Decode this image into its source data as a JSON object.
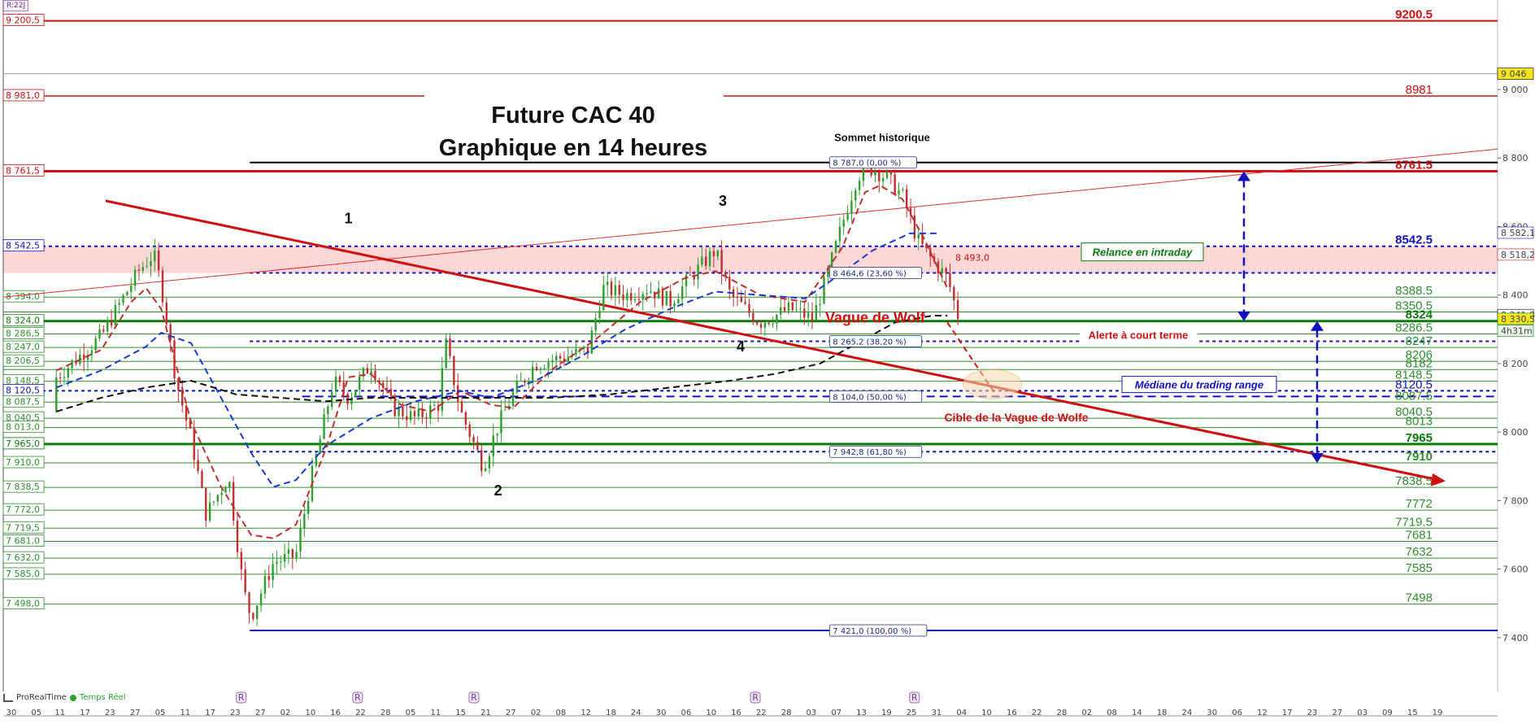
{
  "chart_data": {
    "type": "candlestick",
    "instrument_tag": "R:22J",
    "title_line1": "Future CAC 40",
    "title_line2": "Graphique en 14 heures",
    "footer_brand": "ProRealTime",
    "footer_realtime": "Temps Réel",
    "ylim": [
      7380,
      9240
    ],
    "y_ticks": [
      {
        "value": 9000,
        "label": "9 000"
      },
      {
        "value": 8800,
        "label": "8 800"
      },
      {
        "value": 8600,
        "label": "8 600"
      },
      {
        "value": 8400,
        "label": "8 400"
      },
      {
        "value": 8200,
        "label": "8 200"
      },
      {
        "value": 8000,
        "label": "8 000"
      },
      {
        "value": 7800,
        "label": "7 800"
      },
      {
        "value": 7600,
        "label": "7 600"
      },
      {
        "value": 7400,
        "label": "7 400"
      }
    ],
    "x_ticks": [
      {
        "pos": 0.0,
        "label": "30"
      },
      {
        "pos": 0.017,
        "label": "05"
      },
      {
        "pos": 0.033,
        "label": "11"
      },
      {
        "pos": 0.05,
        "label": "17"
      },
      {
        "pos": 0.067,
        "label": "23"
      },
      {
        "pos": 0.084,
        "label": "27"
      },
      {
        "pos": 0.101,
        "label": "05"
      },
      {
        "pos": 0.118,
        "label": "11"
      },
      {
        "pos": 0.135,
        "label": "17"
      },
      {
        "pos": 0.152,
        "label": "23"
      },
      {
        "pos": 0.169,
        "label": "27"
      },
      {
        "pos": 0.186,
        "label": "02"
      },
      {
        "pos": 0.203,
        "label": "10"
      },
      {
        "pos": 0.22,
        "label": "16"
      },
      {
        "pos": 0.237,
        "label": "22"
      },
      {
        "pos": 0.254,
        "label": "28"
      },
      {
        "pos": 0.271,
        "label": "05"
      },
      {
        "pos": 0.288,
        "label": "11"
      },
      {
        "pos": 0.305,
        "label": "15"
      },
      {
        "pos": 0.322,
        "label": "21"
      },
      {
        "pos": 0.339,
        "label": "27"
      },
      {
        "pos": 0.356,
        "label": "02"
      },
      {
        "pos": 0.373,
        "label": "08"
      },
      {
        "pos": 0.39,
        "label": "12"
      },
      {
        "pos": 0.407,
        "label": "18"
      },
      {
        "pos": 0.424,
        "label": "24"
      },
      {
        "pos": 0.441,
        "label": "30"
      },
      {
        "pos": 0.458,
        "label": "06"
      },
      {
        "pos": 0.475,
        "label": "10"
      },
      {
        "pos": 0.492,
        "label": "16"
      },
      {
        "pos": 0.509,
        "label": "22"
      },
      {
        "pos": 0.526,
        "label": "28"
      },
      {
        "pos": 0.543,
        "label": "03"
      },
      {
        "pos": 0.56,
        "label": "07"
      },
      {
        "pos": 0.577,
        "label": "13"
      },
      {
        "pos": 0.594,
        "label": "19"
      },
      {
        "pos": 0.611,
        "label": "25"
      },
      {
        "pos": 0.628,
        "label": "31"
      },
      {
        "pos": 0.645,
        "label": "04"
      },
      {
        "pos": 0.662,
        "label": "10"
      },
      {
        "pos": 0.679,
        "label": "16"
      },
      {
        "pos": 0.696,
        "label": "22"
      },
      {
        "pos": 0.713,
        "label": "28"
      },
      {
        "pos": 0.73,
        "label": "02"
      },
      {
        "pos": 0.747,
        "label": "08"
      },
      {
        "pos": 0.764,
        "label": "14"
      },
      {
        "pos": 0.781,
        "label": "18"
      },
      {
        "pos": 0.798,
        "label": "24"
      },
      {
        "pos": 0.815,
        "label": "30"
      },
      {
        "pos": 0.832,
        "label": "06"
      },
      {
        "pos": 0.849,
        "label": "12"
      },
      {
        "pos": 0.866,
        "label": "17"
      },
      {
        "pos": 0.883,
        "label": "23"
      },
      {
        "pos": 0.9,
        "label": "27"
      },
      {
        "pos": 0.917,
        "label": "03"
      },
      {
        "pos": 0.934,
        "label": "09"
      },
      {
        "pos": 0.951,
        "label": "15"
      },
      {
        "pos": 0.968,
        "label": "19"
      }
    ],
    "h_levels": [
      {
        "value": 9200.5,
        "left_label": "9 200,5",
        "right_label": "9200.5",
        "color": "#d01010",
        "width": 2,
        "style": "solid",
        "x_from": 0.0,
        "right_bold": true
      },
      {
        "value": 9046,
        "left_label": "",
        "right_label": "",
        "color": "#999999",
        "width": 1,
        "style": "solid",
        "x_from": 0.0
      },
      {
        "value": 8981.0,
        "left_label": "8 981,0",
        "right_label": "8981",
        "color": "#d01010",
        "width": 1.5,
        "style": "gap",
        "x_from": 0.0,
        "right_bold": false
      },
      {
        "value": 8787.0,
        "left_label": "",
        "right_label": "",
        "color": "#000000",
        "width": 2,
        "style": "solid",
        "x_from": 0.165
      },
      {
        "value": 8761.5,
        "left_label": "8 761,5",
        "right_label": "8761.5",
        "color": "#d01010",
        "width": 3,
        "style": "solid",
        "x_from": 0.0,
        "right_bold": true
      },
      {
        "value": 8542.5,
        "left_label": "8 542,5",
        "right_label": "8542.5",
        "color": "#1010c0",
        "width": 2,
        "style": "dot",
        "x_from": 0.0,
        "right_bold": true
      },
      {
        "value": 8464.6,
        "left_label": "",
        "right_label": "",
        "color": "#1010c0",
        "width": 2,
        "style": "dot",
        "x_from": 0.165
      },
      {
        "value": 8394.0,
        "left_label": "8 394,0",
        "right_label": "8388.5",
        "color": "#2f8f2f",
        "width": 1,
        "style": "solid",
        "x_from": 0.0,
        "right_bold": false
      },
      {
        "value": 8350.5,
        "left_label": "",
        "right_label": "8350.5",
        "color": "#2f8f2f",
        "width": 1,
        "style": "solid",
        "x_from": 0.0,
        "right_bold": false
      },
      {
        "value": 8324.0,
        "left_label": "8 324,0",
        "right_label": "8324",
        "color": "#0b7a0b",
        "width": 3,
        "style": "solid",
        "x_from": 0.0,
        "right_bold": true
      },
      {
        "value": 8286.5,
        "left_label": "8 286,5",
        "right_label": "8286.5",
        "color": "#2f8f2f",
        "width": 1,
        "style": "solid",
        "x_from": 0.0,
        "right_bold": false
      },
      {
        "value": 8265.2,
        "left_label": "",
        "right_label": "",
        "color": "#1010c0",
        "width": 2,
        "style": "dot",
        "x_from": 0.165
      },
      {
        "value": 8247.0,
        "left_label": "8 247,0",
        "right_label": "8247",
        "color": "#2f8f2f",
        "width": 1,
        "style": "solid",
        "x_from": 0.0,
        "right_bold": false
      },
      {
        "value": 8206.5,
        "left_label": "8 206,5",
        "right_label": "8206",
        "color": "#2f8f2f",
        "width": 1,
        "style": "solid",
        "x_from": 0.0,
        "right_bold": false
      },
      {
        "value": 8182.5,
        "left_label": "",
        "right_label": "8182",
        "color": "#2f8f2f",
        "width": 1,
        "style": "solid",
        "x_from": 0.0,
        "right_bold": false
      },
      {
        "value": 8148.5,
        "left_label": "8 148,5",
        "right_label": "8148.5",
        "color": "#2f8f2f",
        "width": 1,
        "style": "solid",
        "x_from": 0.0,
        "right_bold": false
      },
      {
        "value": 8120.5,
        "left_label": "8 120,5",
        "right_label": "8120.5",
        "color": "#1010c0",
        "width": 2,
        "style": "dot",
        "x_from": 0.0,
        "right_bold": false
      },
      {
        "value": 8104.0,
        "left_label": "",
        "right_label": "",
        "color": "#1010c0",
        "width": 2,
        "style": "dash",
        "x_from": 0.2
      },
      {
        "value": 8087.5,
        "left_label": "8 087,5",
        "right_label": "8087.5",
        "color": "#2f8f2f",
        "width": 1,
        "style": "solid",
        "x_from": 0.0,
        "right_bold": false
      },
      {
        "value": 8040.5,
        "left_label": "8 040,5",
        "right_label": "8040.5",
        "color": "#2f8f2f",
        "width": 1,
        "style": "solid",
        "x_from": 0.0,
        "right_bold": false
      },
      {
        "value": 8013.0,
        "left_label": "8 013,0",
        "right_label": "8013",
        "color": "#2f8f2f",
        "width": 1,
        "style": "solid",
        "x_from": 0.0,
        "right_bold": false
      },
      {
        "value": 7965.0,
        "left_label": "7 965,0",
        "right_label": "7965",
        "color": "#0b7a0b",
        "width": 3,
        "style": "solid",
        "x_from": 0.0,
        "right_bold": true
      },
      {
        "value": 7942.8,
        "left_label": "",
        "right_label": "",
        "color": "#1010c0",
        "width": 2,
        "style": "dot",
        "x_from": 0.165
      },
      {
        "value": 7910.0,
        "left_label": "7 910,0",
        "right_label": "7910",
        "color": "#2f8f2f",
        "width": 1,
        "style": "solid",
        "x_from": 0.0,
        "right_bold": true
      },
      {
        "value": 7838.5,
        "left_label": "7 838,5",
        "right_label": "7838.5",
        "color": "#2f8f2f",
        "width": 1,
        "style": "solid",
        "x_from": 0.0,
        "right_bold": false
      },
      {
        "value": 7772.0,
        "left_label": "7 772,0",
        "right_label": "7772",
        "color": "#2f8f2f",
        "width": 1,
        "style": "solid",
        "x_from": 0.0,
        "right_bold": false
      },
      {
        "value": 7719.5,
        "left_label": "7 719,5",
        "right_label": "7719.5",
        "color": "#2f8f2f",
        "width": 1,
        "style": "solid",
        "x_from": 0.0,
        "right_bold": false
      },
      {
        "value": 7681.0,
        "left_label": "7 681,0",
        "right_label": "7681",
        "color": "#2f8f2f",
        "width": 1,
        "style": "solid",
        "x_from": 0.0,
        "right_bold": false
      },
      {
        "value": 7632.0,
        "left_label": "7 632,0",
        "right_label": "7632",
        "color": "#2f8f2f",
        "width": 1,
        "style": "solid",
        "x_from": 0.0,
        "right_bold": false
      },
      {
        "value": 7585.0,
        "left_label": "7 585,0",
        "right_label": "7585",
        "color": "#2f8f2f",
        "width": 1,
        "style": "solid",
        "x_from": 0.0,
        "right_bold": false
      },
      {
        "value": 7498.0,
        "left_label": "7 498,0",
        "right_label": "7498",
        "color": "#2f8f2f",
        "width": 1,
        "style": "solid",
        "x_from": 0.0,
        "right_bold": false
      },
      {
        "value": 7421.0,
        "left_label": "",
        "right_label": "",
        "color": "#1010c0",
        "width": 2,
        "style": "solid",
        "x_from": 0.165
      }
    ],
    "fib_labels": [
      {
        "value": 8787.0,
        "text": "8 787,0 (0,00 %)",
        "pos": 0.555
      },
      {
        "value": 8464.6,
        "text": "8 464,6 (23,60 %)",
        "pos": 0.555
      },
      {
        "value": 8265.2,
        "text": "8 265,2 (38,20 %)",
        "pos": 0.555
      },
      {
        "value": 8104.0,
        "text": "8 104,0 (50,00 %)",
        "pos": 0.555
      },
      {
        "value": 7942.8,
        "text": "7 942,8 (61,80 %)",
        "pos": 0.555
      },
      {
        "value": 7421.0,
        "text": "7 421,0 (100,00 %)",
        "pos": 0.555
      }
    ],
    "price_tags": [
      {
        "value": 9046,
        "text": "9 046",
        "bg": "#f5e623",
        "fg": "#000000"
      },
      {
        "value": 8582.1,
        "text": "8 582,1",
        "bg": "#ffffff",
        "fg": "#1010c0"
      },
      {
        "value": 8518.2,
        "text": "8 518,2",
        "bg": "#ffffff",
        "fg": "#d01010"
      },
      {
        "value": 8341.8,
        "text": "8 341,8",
        "bg": "#ffffff",
        "fg": "#000000"
      },
      {
        "value": 8330.5,
        "text": "8 330,5",
        "bg": "#f5e623",
        "fg": "#0b7a0b"
      },
      {
        "value": 8296,
        "text": "4h31m",
        "bg": "#e8f4e8",
        "fg": "#0b7a0b"
      }
    ],
    "wave_labels": [
      {
        "text": "1",
        "x": 0.225,
        "y": 8610
      },
      {
        "text": "2",
        "x": 0.325,
        "y": 7815
      },
      {
        "text": "3",
        "x": 0.475,
        "y": 8660
      },
      {
        "text": "4",
        "x": 0.487,
        "y": 8235
      }
    ],
    "annotations": {
      "sommet": "Sommet historique",
      "vague": "Vague de Wolf",
      "relance": "Relance en intraday",
      "alerte": "Alerte à court terme",
      "mediane": "Médiane du trading range",
      "cible": "Cible de la Vague de Wolfe",
      "small_level": "8 493,0"
    },
    "colors": {
      "bull": "#2fa02f",
      "bear": "#c0302f",
      "resistance": "#d01010",
      "support": "#0b7a0b",
      "fibo": "#1010c0",
      "zone": "#fbd3d3"
    }
  }
}
